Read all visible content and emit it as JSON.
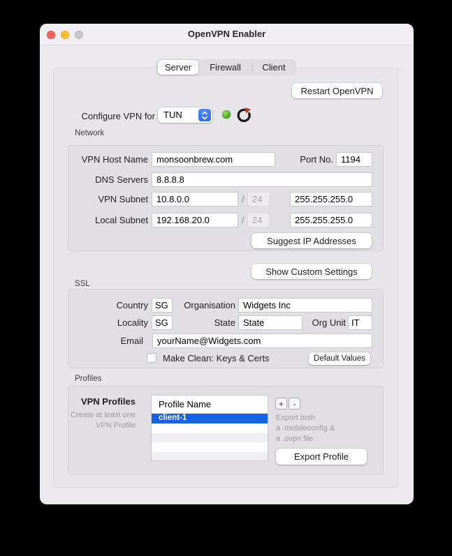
{
  "window": {
    "title": "OpenVPN Enabler"
  },
  "tabs": {
    "items": [
      {
        "label": "Server",
        "selected": true
      },
      {
        "label": "Firewall",
        "selected": false
      },
      {
        "label": "Client",
        "selected": false
      }
    ]
  },
  "toolbar": {
    "restart_label": "Restart OpenVPN"
  },
  "configure": {
    "label": "Configure VPN for",
    "value": "TUN",
    "status_icon": "green-led",
    "refresh_icon": "refresh-arrow"
  },
  "network": {
    "group_label": "Network",
    "host": {
      "label": "VPN Host Name",
      "value": "monsoonbrew.com"
    },
    "port": {
      "label": "Port No.",
      "value": "1194"
    },
    "dns": {
      "label": "DNS Servers",
      "value": "8.8.8.8"
    },
    "vpn_subnet": {
      "label": "VPN Subnet",
      "value": "10.8.0.0",
      "slash": "/",
      "prefix": "24",
      "mask": "255.255.255.0"
    },
    "local_subnet": {
      "label": "Local Subnet",
      "value": "192.168.20.0",
      "slash": "/",
      "prefix": "24",
      "mask": "255.255.255.0"
    },
    "suggest_button": "Suggest IP Addresses"
  },
  "custom_settings_button": "Show Custom Settings",
  "ssl": {
    "group_label": "SSL",
    "country": {
      "label": "Country",
      "value": "SG"
    },
    "organisation": {
      "label": "Organisation",
      "value": "Widgets Inc"
    },
    "locality": {
      "label": "Locality",
      "value": "SG"
    },
    "state": {
      "label": "State",
      "value": "State"
    },
    "org_unit": {
      "label": "Org Unit",
      "value": "IT"
    },
    "email": {
      "label": "Email",
      "value": "yourName@Widgets.com"
    },
    "make_clean": {
      "label": "Make Clean: Keys & Certs",
      "checked": false
    },
    "default_values_button": "Default Values"
  },
  "profiles": {
    "group_label": "Profiles",
    "list_label": "VPN Profiles",
    "helper_line1": "Create at least one",
    "helper_line2": "VPN Profile",
    "table": {
      "header": "Profile Name",
      "rows": [
        {
          "name": "client-1",
          "selected": true
        }
      ]
    },
    "add_button": "+",
    "remove_button": "-",
    "export_note_line1": "Export both",
    "export_note_line2": "a .mobileconfig &",
    "export_note_line3": "a .ovpn file",
    "export_button": "Export Profile"
  },
  "colors": {
    "selection_blue": "#1363E4",
    "popup_blue": "#3B79F7",
    "led_green": "#4CAF1E",
    "refresh_red": "#BF3C1E",
    "traffic_red": "#FF5F57",
    "traffic_yellow": "#FEBC2E",
    "traffic_gray": "#C9C7C9"
  }
}
